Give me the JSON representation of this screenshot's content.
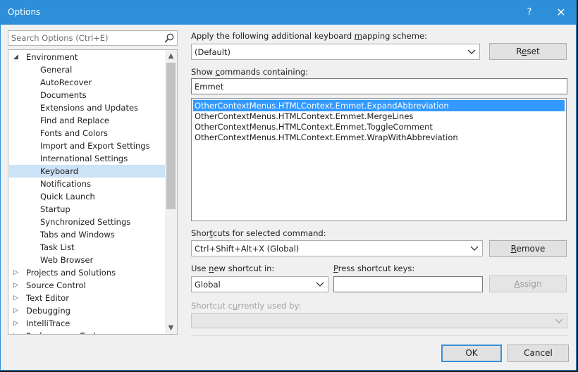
{
  "window": {
    "title": "Options",
    "help_glyph": "?",
    "close_glyph": "✕"
  },
  "search": {
    "placeholder": "Search Options (Ctrl+E)"
  },
  "tree": {
    "items": [
      {
        "label": "Environment",
        "level": 0,
        "expanded": true
      },
      {
        "label": "General",
        "level": 1
      },
      {
        "label": "AutoRecover",
        "level": 1
      },
      {
        "label": "Documents",
        "level": 1
      },
      {
        "label": "Extensions and Updates",
        "level": 1
      },
      {
        "label": "Find and Replace",
        "level": 1
      },
      {
        "label": "Fonts and Colors",
        "level": 1
      },
      {
        "label": "Import and Export Settings",
        "level": 1
      },
      {
        "label": "International Settings",
        "level": 1
      },
      {
        "label": "Keyboard",
        "level": 1,
        "selected": true
      },
      {
        "label": "Notifications",
        "level": 1
      },
      {
        "label": "Quick Launch",
        "level": 1
      },
      {
        "label": "Startup",
        "level": 1
      },
      {
        "label": "Synchronized Settings",
        "level": 1
      },
      {
        "label": "Tabs and Windows",
        "level": 1
      },
      {
        "label": "Task List",
        "level": 1
      },
      {
        "label": "Web Browser",
        "level": 1
      },
      {
        "label": "Projects and Solutions",
        "level": 0,
        "expanded": false
      },
      {
        "label": "Source Control",
        "level": 0,
        "expanded": false
      },
      {
        "label": "Text Editor",
        "level": 0,
        "expanded": false
      },
      {
        "label": "Debugging",
        "level": 0,
        "expanded": false
      },
      {
        "label": "IntelliTrace",
        "level": 0,
        "expanded": false
      },
      {
        "label": "Performance Tools",
        "level": 0,
        "expanded": false
      }
    ]
  },
  "mapping": {
    "label_pre": "Apply the following additional keyboard ",
    "label_key": "m",
    "label_post": "apping scheme:",
    "value": "(Default)",
    "reset_pre": "R",
    "reset_key": "e",
    "reset_post": "set"
  },
  "commands": {
    "label_pre": "Show ",
    "label_key": "c",
    "label_post": "ommands containing:",
    "filter": "Emmet",
    "items": [
      {
        "text": "OtherContextMenus.HTMLContext.Emmet.ExpandAbbreviation",
        "selected": true
      },
      {
        "text": "OtherContextMenus.HTMLContext.Emmet.MergeLines"
      },
      {
        "text": "OtherContextMenus.HTMLContext.Emmet.ToggleComment"
      },
      {
        "text": "OtherContextMenus.HTMLContext.Emmet.WrapWithAbbreviation"
      }
    ]
  },
  "shortcuts": {
    "label_pre": "Shor",
    "label_key": "t",
    "label_post": "cuts for selected command:",
    "value": "Ctrl+Shift+Alt+X (Global)",
    "remove_pre": "",
    "remove_key": "R",
    "remove_post": "emove"
  },
  "new_shortcut": {
    "use_pre": "Use ",
    "use_key": "n",
    "use_post": "ew shortcut in:",
    "scope": "Global",
    "press_pre": "",
    "press_key": "P",
    "press_post": "ress shortcut keys:",
    "keys_value": "",
    "assign_pre": "",
    "assign_key": "A",
    "assign_post": "ssign"
  },
  "used_by": {
    "label_pre": "Shortcut c",
    "label_key": "u",
    "label_post": "rrently used by:",
    "value": ""
  },
  "footer": {
    "ok": "OK",
    "cancel": "Cancel"
  },
  "colors": {
    "titlebar": "#2d8fd9",
    "selection": "#3399ff",
    "tree_selection": "#cce2f6"
  }
}
